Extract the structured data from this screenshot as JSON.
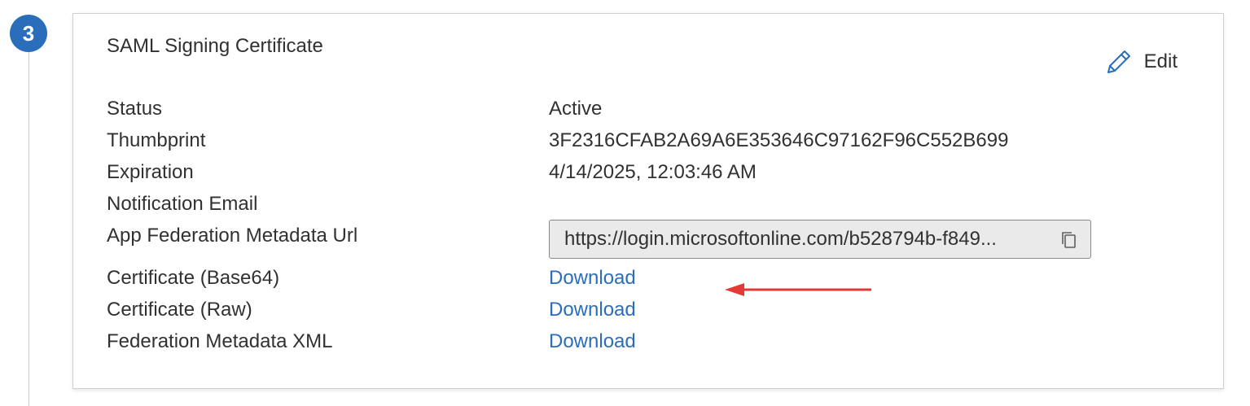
{
  "step": {
    "number": "3"
  },
  "card": {
    "title": "SAML Signing Certificate",
    "edit_label": "Edit"
  },
  "rows": {
    "status": {
      "label": "Status",
      "value": "Active"
    },
    "thumbprint": {
      "label": "Thumbprint",
      "value": "3F2316CFAB2A69A6E353646C97162F96C552B699"
    },
    "expiration": {
      "label": "Expiration",
      "value": "4/14/2025, 12:03:46 AM"
    },
    "notification_email": {
      "label": "Notification Email",
      "value": ""
    },
    "metadata_url": {
      "label": "App Federation Metadata Url",
      "value": "https://login.microsoftonline.com/b528794b-f849..."
    },
    "cert_base64": {
      "label": "Certificate (Base64)",
      "link": "Download"
    },
    "cert_raw": {
      "label": "Certificate (Raw)",
      "link": "Download"
    },
    "federation_xml": {
      "label": "Federation Metadata XML",
      "link": "Download"
    }
  },
  "icons": {
    "edit": "pencil-icon",
    "copy": "copy-icon",
    "annotation": "red-arrow"
  },
  "colors": {
    "accent": "#2a6ebb",
    "annotation_arrow": "#e53935",
    "field_background": "#eaeaea"
  }
}
